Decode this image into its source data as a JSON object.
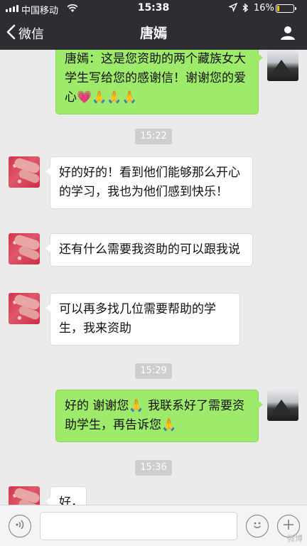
{
  "status_bar": {
    "carrier": "中国移动",
    "time": "15:38",
    "battery": "16%",
    "battery_level": 0.16
  },
  "nav": {
    "back_label": "微信",
    "title": "唐嫣"
  },
  "messages": [
    {
      "type": "message",
      "side": "right",
      "text": "唐嫣：这是您资助的两个藏族女大学生写给您的感谢信！谢谢您的爱心💗🙏🙏🙏"
    },
    {
      "type": "timestamp",
      "text": "15:22"
    },
    {
      "type": "message",
      "side": "left",
      "text": "好的好的！看到他们能够那么开心的学习，我也为他们感到快乐！"
    },
    {
      "type": "message",
      "side": "left",
      "text": "还有什么需要我资助的可以跟我说"
    },
    {
      "type": "message",
      "side": "left",
      "text": "可以再多找几位需要帮助的学生，我来资助"
    },
    {
      "type": "timestamp",
      "text": "15:29"
    },
    {
      "type": "message",
      "side": "right",
      "text": "好的 谢谢您🙏 我联系好了需要资助学生，再告诉您🙏"
    },
    {
      "type": "timestamp",
      "text": "15:36"
    },
    {
      "type": "message",
      "side": "left",
      "text": "好，"
    }
  ],
  "input_bar": {
    "text_value": "",
    "watermark": "微博"
  },
  "icons": {
    "signal": "signal-icon",
    "wifi": "wifi-icon",
    "location": "location-icon",
    "bluetooth": "bluetooth-icon",
    "battery": "battery-icon",
    "back": "chevron-left-icon",
    "profile": "person-icon",
    "voice": "voice-icon",
    "emoji": "emoji-icon",
    "add": "plus-icon"
  },
  "colors": {
    "nav_background": "#2e2e32",
    "chat_background": "#ebebeb",
    "self_bubble": "#9eea6a",
    "friend_bubble": "#ffffff",
    "timestamp_chip": "#cecece",
    "battery_fill": "#f5c400"
  }
}
